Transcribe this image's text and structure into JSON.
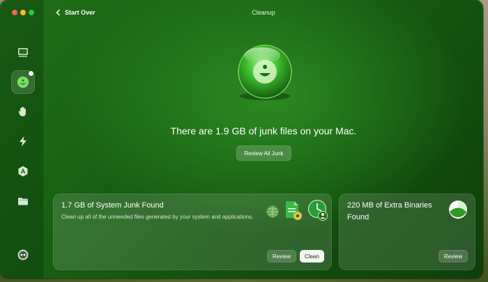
{
  "window": {
    "title": "Cleanup"
  },
  "header": {
    "back_label": "Start Over"
  },
  "sidebar": {
    "items": [
      {
        "icon": "disk-drive-icon",
        "active": false
      },
      {
        "icon": "cleanup-orb-icon",
        "active": true
      },
      {
        "icon": "hand-icon",
        "active": false
      },
      {
        "icon": "lightning-icon",
        "active": false
      },
      {
        "icon": "app-store-icon",
        "active": false
      },
      {
        "icon": "folder-icon",
        "active": false
      }
    ],
    "footer_icon": "assistant-icon"
  },
  "hero": {
    "headline": "There are 1.9 GB of junk files on your Mac.",
    "review_all_label": "Review All Junk"
  },
  "cards": [
    {
      "title": "1.7 GB of System Junk Found",
      "description": "Clean up all of the unneeded files generated by your system and applications.",
      "review_label": "Review",
      "clean_label": "Clean",
      "icons": [
        "globe-icon",
        "document-gear-icon",
        "clock-user-icon"
      ]
    },
    {
      "title": "220 MB of Extra Binaries Found",
      "review_label": "Review",
      "icons": [
        "binaries-pie-icon"
      ]
    }
  ],
  "colors": {
    "accent": "#1f6f18",
    "button_white": "#f4f6f2"
  }
}
